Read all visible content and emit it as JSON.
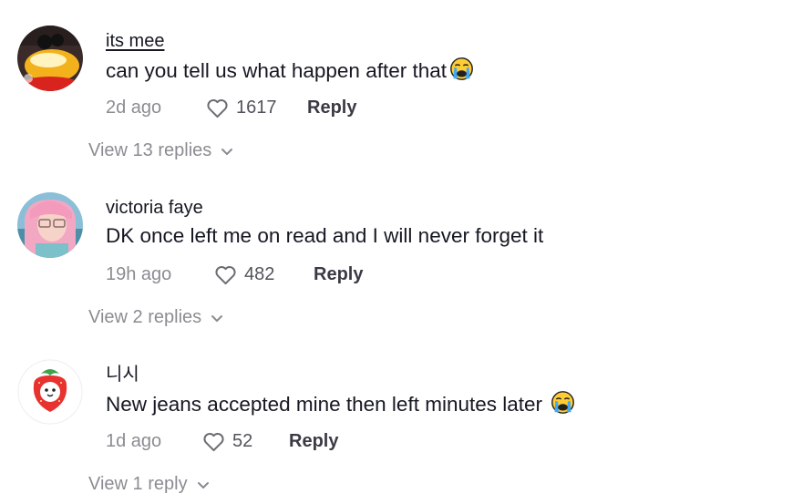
{
  "comments": [
    {
      "username": "its mee",
      "text": "can you tell us what happen after that",
      "emoji": "loudly-crying-face",
      "time": "2d ago",
      "likes": "1617",
      "reply_label": "Reply",
      "view_replies": "View 13 replies"
    },
    {
      "username": "victoria faye",
      "text": "DK once left me on read and I will never forget it",
      "time": "19h ago",
      "likes": "482",
      "reply_label": "Reply",
      "view_replies": "View 2 replies"
    },
    {
      "username": "니시",
      "text": "New jeans accepted mine then left minutes later ",
      "emoji": "loudly-crying-face",
      "time": "1d ago",
      "likes": "52",
      "reply_label": "Reply",
      "view_replies": "View 1 reply"
    }
  ],
  "colors": {
    "text_primary": "#161823",
    "text_secondary": "#8a8b91",
    "background": "#ffffff"
  }
}
